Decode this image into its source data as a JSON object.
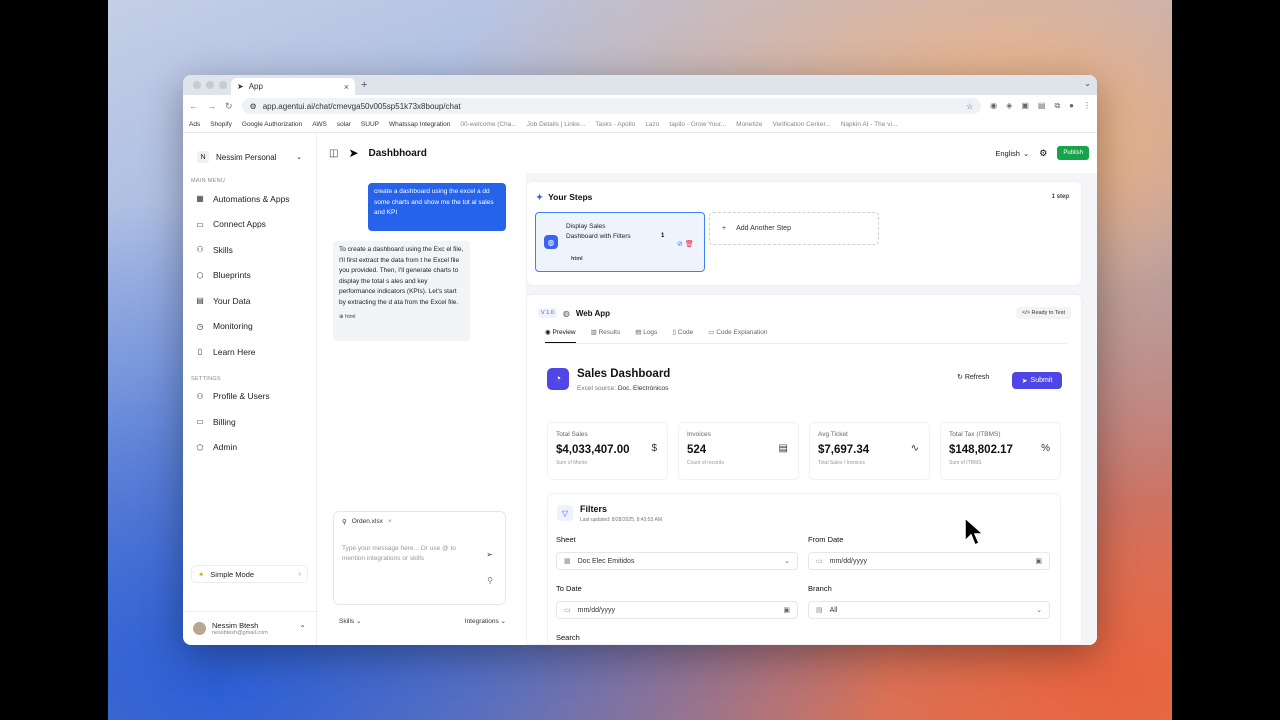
{
  "browser": {
    "tab_title": "App",
    "url": "app.agentui.ai/chat/cmevga50v005sp51k73x8boup/chat",
    "bookmarks": [
      "Ads",
      "Shopify",
      "Google Authorization",
      "AWS",
      "solar",
      "SUUP",
      "Whatssap Integration",
      "00-welcome (Cha...",
      "Job Details | Linke...",
      "Tasks - Apollo",
      "Lazo",
      "tapilo - Grow Your...",
      "Monetize",
      "Verification Center...",
      "Napkin AI - The vi..."
    ]
  },
  "sidebar": {
    "workspace_initial": "N",
    "workspace": "Nessim Personal",
    "main_menu_label": "MAIN MENU",
    "items": [
      {
        "label": "Automations & Apps",
        "icon": "grid-icon"
      },
      {
        "label": "Connect Apps",
        "icon": "window-icon"
      },
      {
        "label": "Skills",
        "icon": "skills-icon"
      },
      {
        "label": "Blueprints",
        "icon": "cube-icon"
      },
      {
        "label": "Your Data",
        "icon": "table-icon"
      },
      {
        "label": "Monitoring",
        "icon": "clock-icon"
      },
      {
        "label": "Learn Here",
        "icon": "book-icon"
      }
    ],
    "settings_label": "SETTINGS",
    "settings_items": [
      {
        "label": "Profile & Users",
        "icon": "users-icon"
      },
      {
        "label": "Billing",
        "icon": "card-icon"
      },
      {
        "label": "Admin",
        "icon": "shield-icon"
      }
    ],
    "simple_mode": "Simple Mode",
    "user_name": "Nessim Btesh",
    "user_email": "nessbtesh@gmail.com"
  },
  "header": {
    "title": "Dashbhoard",
    "language": "English",
    "publish": "Publish"
  },
  "chat": {
    "user_message": "create a dashboard using the excel a dd some charts and show me the tot al sales and KPI",
    "ai_message": "To create a dashboard using the Exc el file, I'll first extract the data from t he Excel file you provided. Then, I'll generate charts to display the total s ales and key performance indicators (KPIs). Let's start by extracting the d ata from the Excel file.",
    "ai_tag": "html",
    "attachment": "Orden.xlsx",
    "input_placeholder": "Type your message here... Or use @ to mention integrations or skills",
    "skills": "Skills",
    "integrations": "Integrations"
  },
  "steps": {
    "title": "Your Steps",
    "count": "1 step",
    "step_title": "Display Sales Dashboard with Filters",
    "step_tag": "html",
    "step_number": "1",
    "add_step": "Add Another Step"
  },
  "webapp": {
    "version": "V 1.0",
    "title": "Web App",
    "ready": "Ready to Test",
    "tabs": [
      "Preview",
      "Results",
      "Logs",
      "Code",
      "Code Explanation"
    ],
    "dashboard_title": "Sales Dashboard",
    "source_prefix": "Excel source:",
    "source_name": "Doc. Electrónicos",
    "refresh": "Refresh",
    "submit": "Submit",
    "kpis": [
      {
        "label": "Total Sales",
        "value": "$4,033,407.00",
        "sub": "Sum of Monto",
        "icon": "$"
      },
      {
        "label": "Invoices",
        "value": "524",
        "sub": "Count of records",
        "icon": "▤"
      },
      {
        "label": "Avg Ticket",
        "value": "$7,697.34",
        "sub": "Total Sales / Invoices",
        "icon": "∿"
      },
      {
        "label": "Total Tax (ITBMS)",
        "value": "$148,802.17",
        "sub": "Sum of ITBMS",
        "icon": "%"
      }
    ],
    "filters": {
      "title": "Filters",
      "updated": "Last updated: 8/28/2025, 8:43:53 AM",
      "sheet_label": "Sheet",
      "sheet_value": "Doc Elec Emitidos",
      "from_label": "From Date",
      "from_value": "mm/dd/yyyy",
      "to_label": "To Date",
      "to_value": "mm/dd/yyyy",
      "branch_label": "Branch",
      "branch_value": "All",
      "search_label": "Search"
    }
  }
}
